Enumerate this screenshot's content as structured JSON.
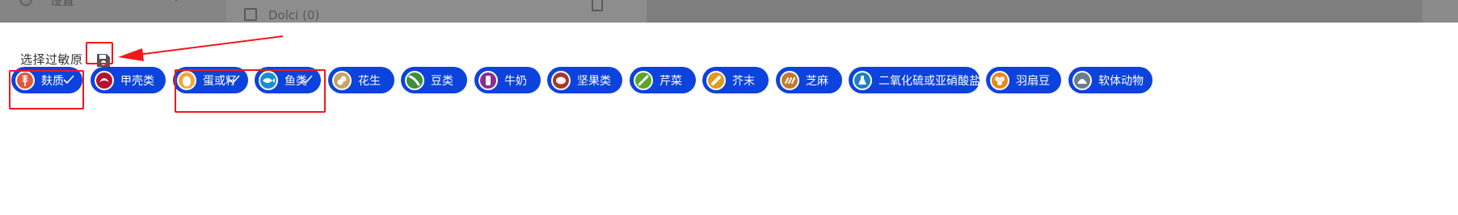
{
  "background": {
    "settings_label": "设置",
    "list_item_label": "Dolci (0)"
  },
  "dialog": {
    "title": "选择过敏原",
    "save_icon": "floppy-disk-icon"
  },
  "allergens": [
    {
      "label": "麸质",
      "icon": "wheat-icon",
      "icon_color": "#e2583a",
      "selected": true
    },
    {
      "label": "甲壳类",
      "icon": "crustacean-icon",
      "icon_color": "#b5122e",
      "selected": false
    },
    {
      "label": "蛋或籽",
      "icon": "egg-icon",
      "icon_color": "#f3a73a",
      "selected": true
    },
    {
      "label": "鱼类",
      "icon": "fish-icon",
      "icon_color": "#1a8fcf",
      "selected": true
    },
    {
      "label": "花生",
      "icon": "peanut-icon",
      "icon_color": "#c8a45e",
      "selected": false
    },
    {
      "label": "豆类",
      "icon": "soybean-icon",
      "icon_color": "#3f8f3a",
      "selected": false
    },
    {
      "label": "牛奶",
      "icon": "milk-icon",
      "icon_color": "#8e2c8f",
      "selected": false
    },
    {
      "label": "坚果类",
      "icon": "nut-icon",
      "icon_color": "#a4382a",
      "selected": false
    },
    {
      "label": "芹菜",
      "icon": "celery-icon",
      "icon_color": "#5aa62c",
      "selected": false
    },
    {
      "label": "芥末",
      "icon": "mustard-icon",
      "icon_color": "#e29a1b",
      "selected": false
    },
    {
      "label": "芝麻",
      "icon": "sesame-icon",
      "icon_color": "#c07a2c",
      "selected": false
    },
    {
      "label": "二氧化硫或亚硝酸盐",
      "icon": "sulphite-flask-icon",
      "icon_color": "#1d7fc4",
      "selected": false
    },
    {
      "label": "羽扇豆",
      "icon": "lupin-icon",
      "icon_color": "#e88a1a",
      "selected": false
    },
    {
      "label": "软体动物",
      "icon": "mollusc-icon",
      "icon_color": "#6a7d8e",
      "selected": false
    }
  ],
  "colors": {
    "chip_background": "#0c43dc",
    "annotation_red": "#f2171b"
  }
}
